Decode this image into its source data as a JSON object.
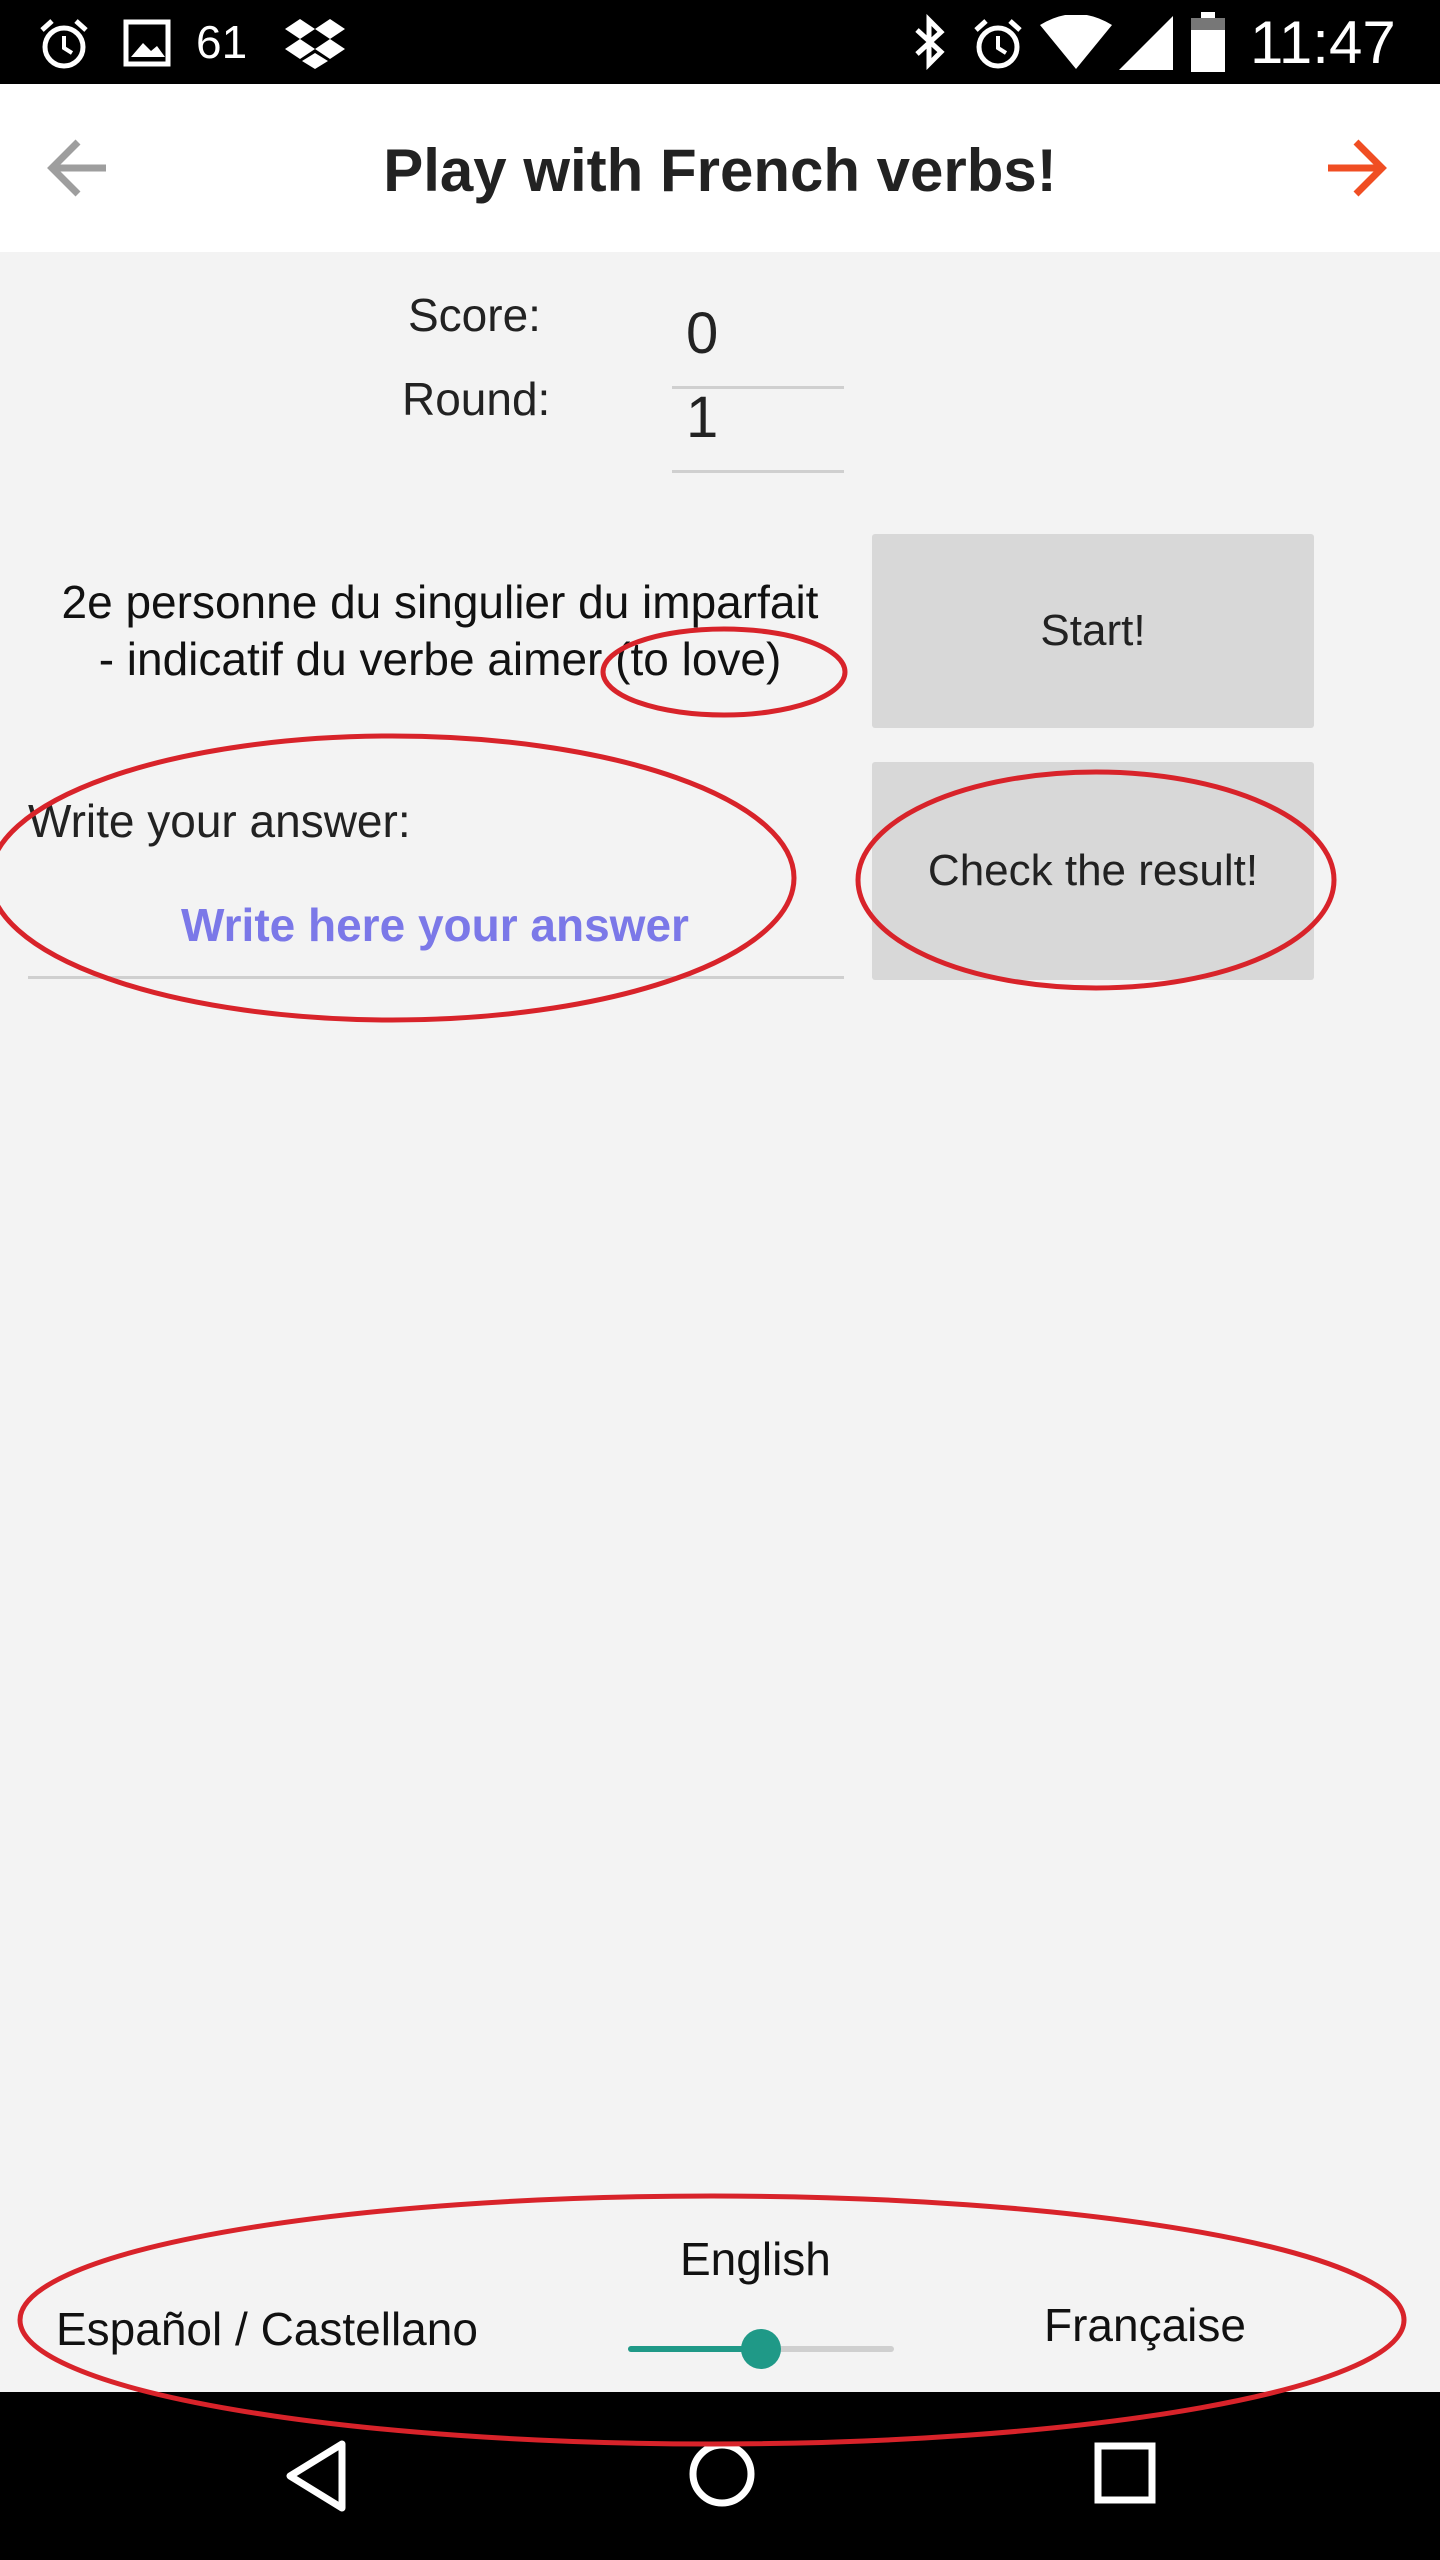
{
  "status_bar": {
    "notification_count": "61",
    "time": "11:47",
    "icons": [
      "alarm-icon",
      "image-icon",
      "dropbox-icon",
      "bluetooth-icon",
      "alarm-icon",
      "wifi-icon",
      "signal-icon",
      "battery-icon"
    ]
  },
  "app_bar": {
    "title": "Play with French verbs!",
    "back_icon": "arrow-left-icon",
    "forward_icon": "arrow-right-icon",
    "forward_color": "#f04e23"
  },
  "game": {
    "score_label": "Score:",
    "score_value": "0",
    "round_label": "Round:",
    "round_value": "1",
    "question_line1": "2e personne du singulier du imparfait",
    "question_line2": "- indicatif du verbe aimer (to love)",
    "start_button": "Start!",
    "check_button": "Check the result!",
    "answer_label": "Write your answer:",
    "answer_placeholder": "Write here your answer",
    "answer_value": ""
  },
  "language": {
    "left_label": "Español / Castellano",
    "center_label": "English",
    "right_label": "Française",
    "slider_level": 0.5,
    "accent_color": "#1f9987"
  },
  "annotation_color": "#d8232a"
}
